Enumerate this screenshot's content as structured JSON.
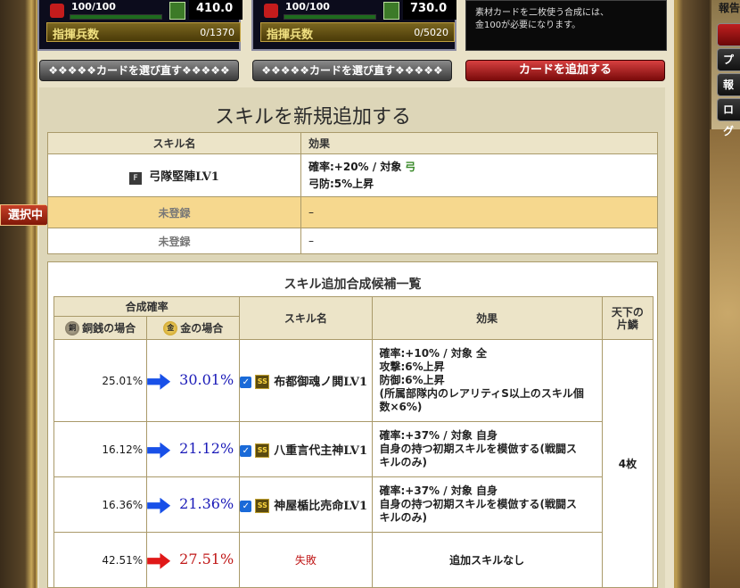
{
  "cards": [
    {
      "hp": "100/100",
      "cost": "410.0",
      "command_label": "指揮兵数",
      "command_value": "0/1370"
    },
    {
      "hp": "100/100",
      "cost": "730.0",
      "command_label": "指揮兵数",
      "command_value": "0/5020"
    }
  ],
  "notice": [
    "素材カードを二枚使う合成には、",
    "金100が必要になります。"
  ],
  "buttons": {
    "reselect_1": "❖❖❖❖❖カードを選び直す❖❖❖❖❖",
    "reselect_2": "❖❖❖❖❖カードを選び直す❖❖❖❖❖",
    "add_card": "カードを追加する"
  },
  "side": {
    "report_title": "報告",
    "items": [
      "",
      "プ",
      "報告",
      "ログ"
    ]
  },
  "panel_title": "スキルを新規追加する",
  "selected_tag": "選択中",
  "skill_table": {
    "headers": [
      "スキル名",
      "効果"
    ],
    "rows": [
      {
        "rank": "F",
        "name": "弓隊堅陣LV1",
        "effect_line1": "確率:+20% / 対象",
        "target": "弓",
        "effect_line2": "弓防:5%上昇"
      },
      {
        "name": "未登録",
        "effect": "–"
      },
      {
        "name": "未登録",
        "effect": "–"
      }
    ]
  },
  "candidates": {
    "title": "スキル追加合成候補一覧",
    "headers": {
      "rate": "合成確率",
      "copper": "銅銭の場合",
      "gold": "金の場合",
      "name": "スキル名",
      "effect": "効果",
      "fragment_line1": "天下の",
      "fragment_line2": "片鱗"
    },
    "coin_copper": "銅",
    "coin_gold": "金",
    "fragment_value": "4枚",
    "rows": [
      {
        "copper": "25.01%",
        "gold": "30.01%",
        "rank": "SS",
        "name": "布都御魂ノ閧LV1",
        "effect": [
          "確率:+10% / 対象 全",
          "攻撃:6%上昇",
          "防御:6%上昇",
          "(所属部隊内のレアリティS以上のスキル個",
          "数×6%)"
        ]
      },
      {
        "copper": "16.12%",
        "gold": "21.12%",
        "rank": "SS",
        "name": "八重言代主神LV1",
        "effect": [
          "確率:+37% / 対象 自身",
          "自身の持つ初期スキルを模倣する(戦闘ス",
          "キルのみ)"
        ]
      },
      {
        "copper": "16.36%",
        "gold": "21.36%",
        "rank": "SS",
        "name": "神屋楯比売命LV1",
        "effect": [
          "確率:+37% / 対象 自身",
          "自身の持つ初期スキルを模倣する(戦闘ス",
          "キルのみ)"
        ]
      },
      {
        "copper": "42.51%",
        "gold": "27.51%",
        "name": "失敗",
        "effect": [
          "追加スキルなし"
        ]
      }
    ]
  }
}
